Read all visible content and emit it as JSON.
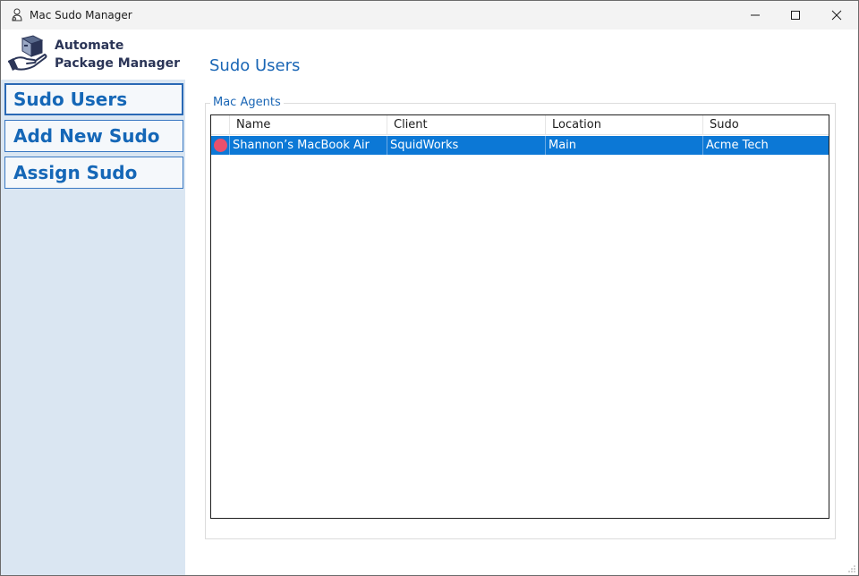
{
  "window": {
    "title": "Mac Sudo Manager"
  },
  "brand": {
    "line1": "Automate",
    "line2": "Package Manager"
  },
  "sidebar": {
    "items": [
      {
        "label": "Sudo Users",
        "active": true
      },
      {
        "label": "Add New Sudo",
        "active": false
      },
      {
        "label": "Assign Sudo",
        "active": false
      }
    ]
  },
  "main": {
    "title": "Sudo Users",
    "group_label": "Mac Agents",
    "table": {
      "columns": [
        "Name",
        "Client",
        "Location",
        "Sudo"
      ],
      "rows": [
        {
          "status": "offline",
          "name": "Shannon’s MacBook Air",
          "client": "SquidWorks",
          "location": "Main",
          "sudo": "Acme Tech",
          "selected": true
        }
      ]
    }
  },
  "colors": {
    "accent": "#1a66b5",
    "selection": "#0c78d6",
    "sidebar_bg": "#dae6f2",
    "status_dot": "#e9506b"
  },
  "icons": {
    "app": "user-gear-icon",
    "brand": "package-hand-icon"
  }
}
